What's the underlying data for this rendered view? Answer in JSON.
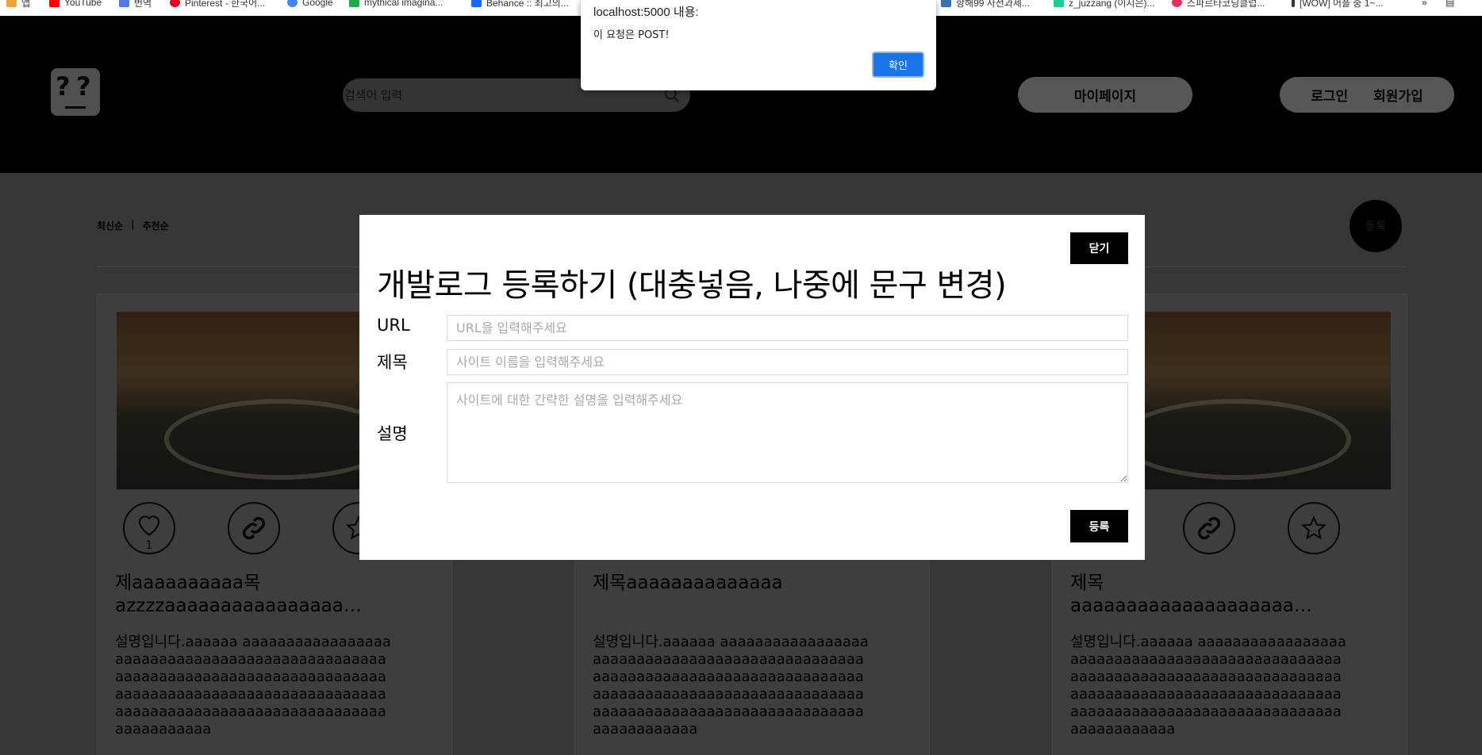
{
  "bookmarks": [
    {
      "label": "앱",
      "icon": "apps-grid-icon",
      "color": "#e8a33d"
    },
    {
      "label": "YouTube",
      "icon": "youtube-icon",
      "color": "#ff0000"
    },
    {
      "label": "번역",
      "icon": "translate-icon",
      "color": "#4a7be0"
    },
    {
      "label": "Pinterest - 한국어...",
      "icon": "pinterest-icon",
      "color": "#e60023"
    },
    {
      "label": "Google",
      "icon": "google-icon",
      "color": "#4285f4"
    },
    {
      "label": "mythical imagina...",
      "icon": "bookmark-icon",
      "color": "#22a84a"
    },
    {
      "label": "Behance :: 최고의...",
      "icon": "behance-icon",
      "color": "#1769ff"
    },
    {
      "label": "항해99 사전과제...",
      "icon": "bookmark-icon",
      "color": "#3a6fb0"
    },
    {
      "label": "z_juzzang (이지은)...",
      "icon": "bookmark-icon",
      "color": "#20c997"
    },
    {
      "label": "스파르타코딩클럽...",
      "icon": "bookmark-icon",
      "color": "#e0335c"
    },
    {
      "label": "[WOW] 어플 중 1~...",
      "icon": "bookmark-icon",
      "color": "#333333"
    }
  ],
  "alert": {
    "title": "localhost:5000 내용:",
    "message": "이 요청은 POST!",
    "ok_label": "확인"
  },
  "header": {
    "logo_text": "??",
    "search_placeholder": "검색어 입력",
    "mypage_label": "마이페이지",
    "login_label": "로그인",
    "signup_label": "회원가입"
  },
  "sort": {
    "latest": "최신순",
    "separator": "|",
    "recommended": "추천순"
  },
  "fab_label": "등록",
  "cards": [
    {
      "title_line1": "제aaaaaaaaaa목",
      "title_line2": "azzzzaaaaaaaaaaaaaaaa…",
      "like_count": "1",
      "description": "설명입니다.aaaaaa aaaaaaaaaaaaaaaaaaaaaaaaaaaaaaaaaaaaaaaaaaaaaaaaaaaaaaaaaaaaaaaaaaaaaaaaaaaaaaaaaaaaaaaaaaaaaaaaaaaaaaaaaaaaaaaaaaaaaaaaaaaaaaaaaaaaaaaaaaaaaaaaaaaaaaaa"
    },
    {
      "title_line1": "제목aaaaaaaaaaaaaa",
      "title_line2": "",
      "like_count": "",
      "description": "설명입니다.aaaaaa aaaaaaaaaaaaaaaaaaaaaaaaaaaaaaaaaaaaaaaaaaaaaaaaaaaaaaaaaaaaaaaaaaaaaaaaaaaaaaaaaaaaaaaaaaaaaaaaaaaaaaaaaaaaaaaaaaaaaaaaaaaaaaaaaaaaaaaaaaaaaaaaaaaaaaaaa"
    },
    {
      "title_line1": "제목",
      "title_line2": "aaaaaaaaaaaaaaaaaaaa…",
      "like_count": "",
      "description": "설명입니다.aaaaaa aaaaaaaaaaaaaaaaaaaaaaaaaaaaaaaaaaaaaaaaaaaaaaaaaaaaaaaaaaaaaaaaaaaaaaaaaaaaaaaaaaaaaaaaaaaaaaaaaaaaaaaaaaaaaaaaaaaaaaaaaaaaaaaaaaaaaaaaaaaaaaaaaaaaaaaaa"
    }
  ],
  "modal": {
    "close_label": "닫기",
    "title": "개발로그 등록하기 (대충넣음, 나중에 문구 변경)",
    "url_label": "URL",
    "url_placeholder": "URL을 입력해주세요",
    "title_label": "제목",
    "title_placeholder": "사이트 이름을 입력해주세요",
    "desc_label": "설명",
    "desc_placeholder": "사이트에 대한 간략한 설명을 입력해주세요",
    "submit_label": "등록"
  }
}
